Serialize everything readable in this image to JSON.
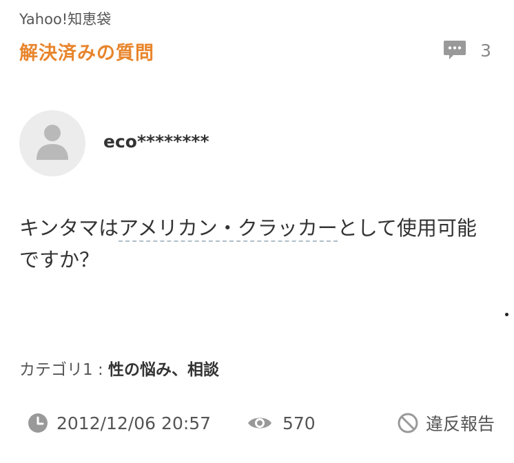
{
  "site_name": "Yahoo!知恵袋",
  "status_label": "解決済みの質問",
  "answers": {
    "icon": "comment-bubble-icon",
    "count": "3"
  },
  "user": {
    "avatar_icon": "default-user-icon",
    "name": "eco********"
  },
  "question": {
    "text_before": "キンタマは",
    "keyword": "アメリカン・クラッカー",
    "text_after": "として使用可能ですか？"
  },
  "category": {
    "label": "カテゴリ1 : ",
    "value": "性の悩み、相談"
  },
  "meta": {
    "datetime": "2012/12/06 20:57",
    "views": "570",
    "report_label": "違反報告",
    "clock_icon": "clock-icon",
    "eye_icon": "eye-icon",
    "report_icon": "prohibited-icon"
  },
  "colors": {
    "accent": "#e8852c",
    "text": "#333333",
    "muted": "#888888",
    "icon": "#999999"
  }
}
